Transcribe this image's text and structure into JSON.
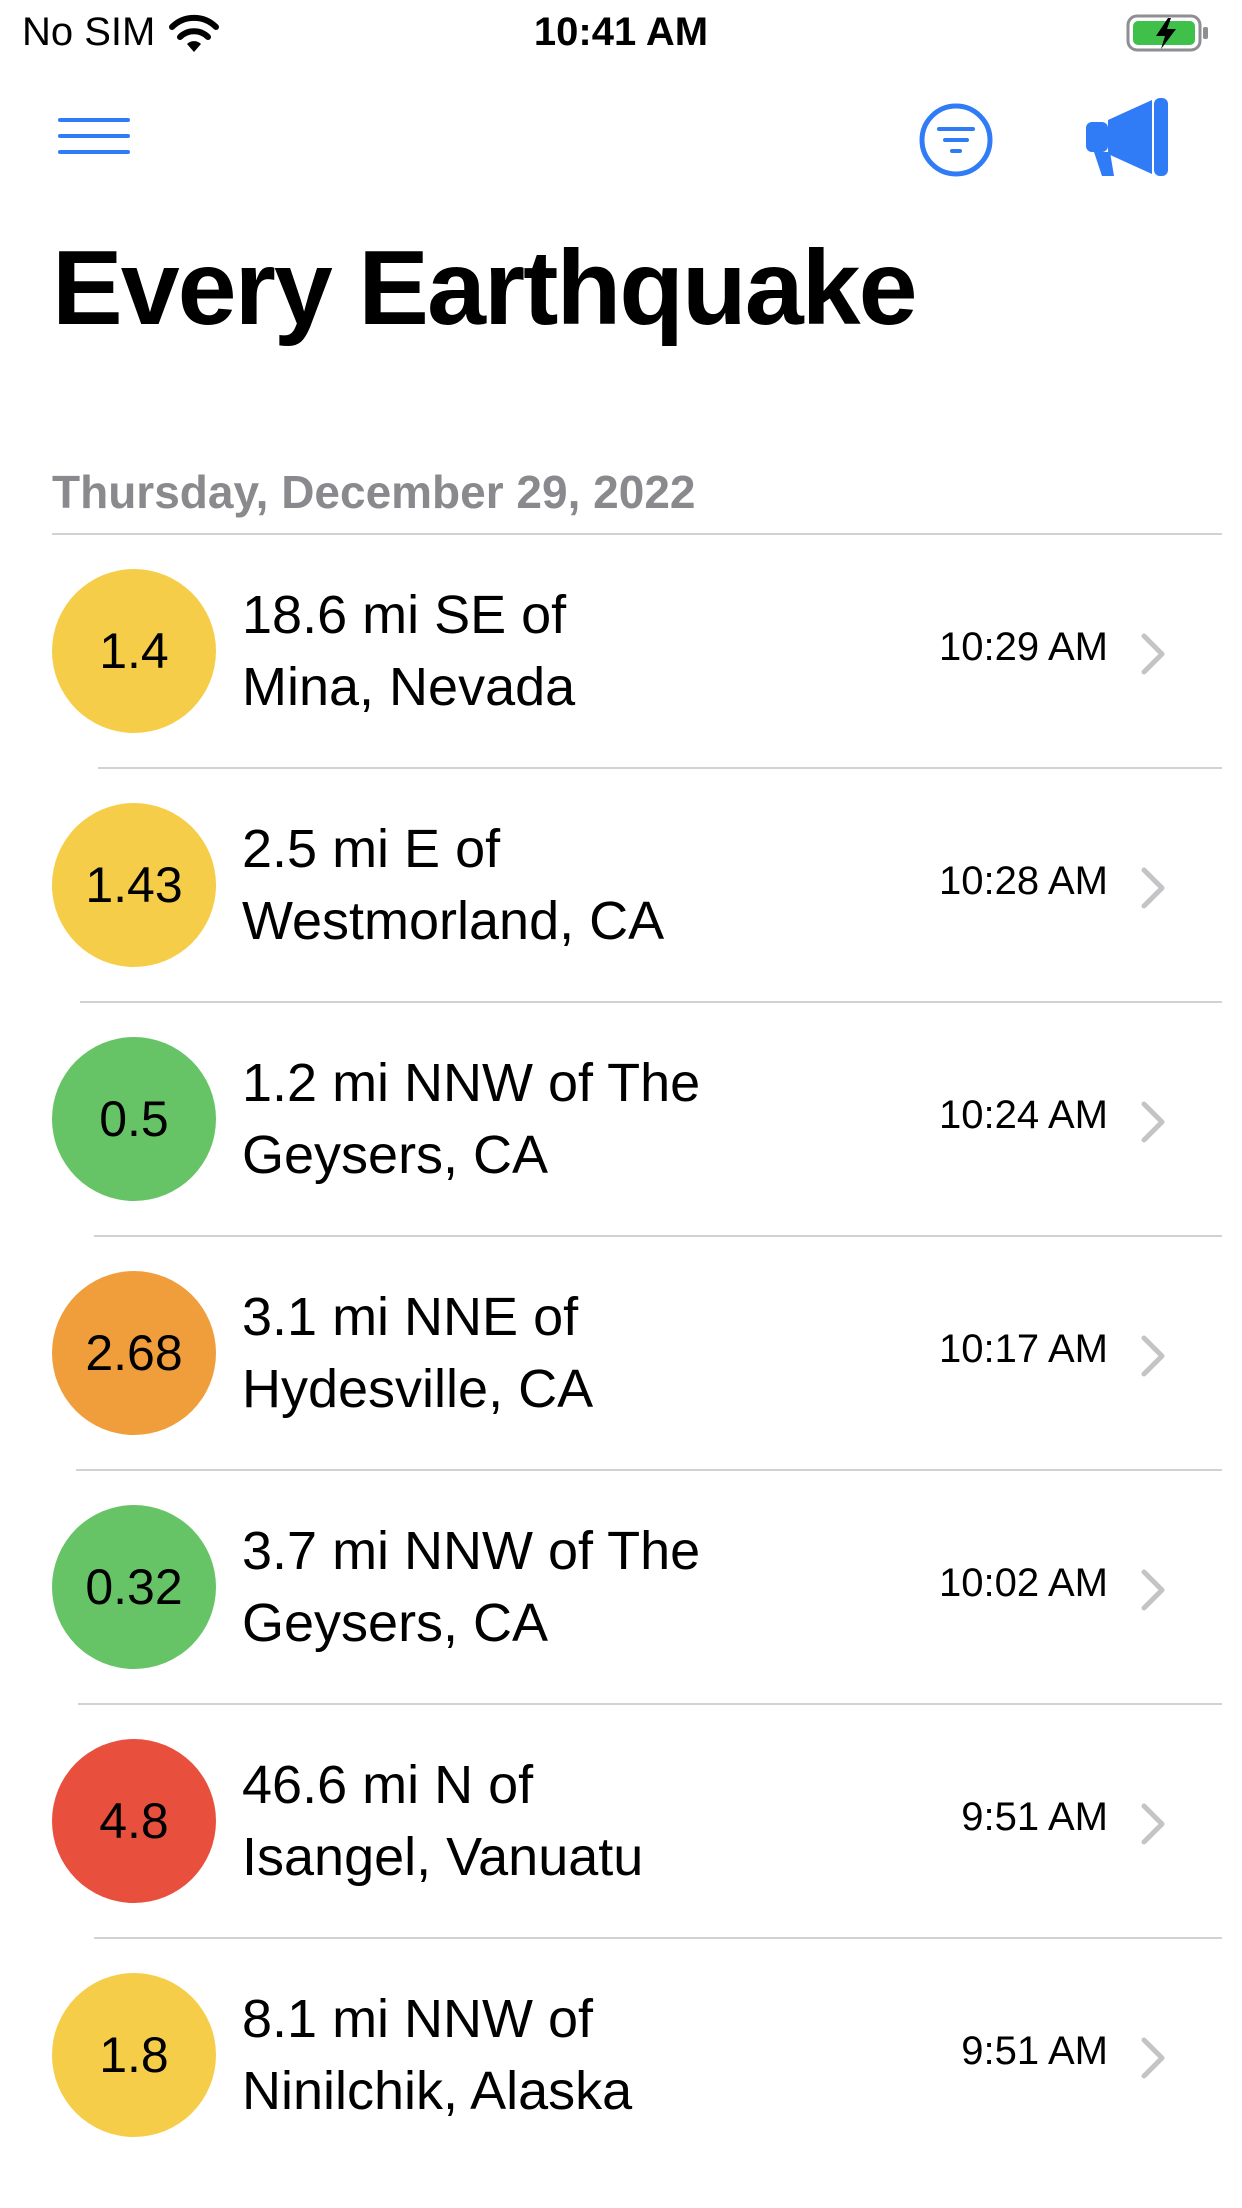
{
  "status_bar": {
    "carrier": "No SIM",
    "time": "10:41 AM"
  },
  "nav": {
    "menu_icon": "hamburger-menu-icon",
    "filter_icon": "filter-circle-icon",
    "announce_icon": "megaphone-icon",
    "accent_color": "#2f7cf6"
  },
  "title": "Every Earthquake",
  "section": {
    "header": "Thursday, December 29, 2022"
  },
  "colors": {
    "yellow": "#f6cd48",
    "green": "#66c466",
    "orange": "#f09d3b",
    "red": "#e94f3d"
  },
  "earthquakes": [
    {
      "magnitude": "1.4",
      "place_line1": "18.6 mi SE of",
      "place_line2": "Mina, Nevada",
      "time": "10:29 AM",
      "color": "#f6cd48"
    },
    {
      "magnitude": "1.43",
      "place_line1": "2.5 mi E of",
      "place_line2": "Westmorland, CA",
      "time": "10:28 AM",
      "color": "#f6cd48"
    },
    {
      "magnitude": "0.5",
      "place_line1": "1.2 mi NNW of The",
      "place_line2": "Geysers, CA",
      "time": "10:24 AM",
      "color": "#66c466"
    },
    {
      "magnitude": "2.68",
      "place_line1": "3.1 mi NNE of",
      "place_line2": "Hydesville, CA",
      "time": "10:17 AM",
      "color": "#f09d3b"
    },
    {
      "magnitude": "0.32",
      "place_line1": "3.7 mi NNW of The",
      "place_line2": "Geysers, CA",
      "time": "10:02 AM",
      "color": "#66c466"
    },
    {
      "magnitude": "4.8",
      "place_line1": "46.6 mi N of",
      "place_line2": "Isangel, Vanuatu",
      "time": "9:51 AM",
      "color": "#e94f3d"
    },
    {
      "magnitude": "1.8",
      "place_line1": "8.1 mi NNW of",
      "place_line2": "Ninilchik, Alaska",
      "time": "9:51 AM",
      "color": "#f6cd48"
    }
  ]
}
